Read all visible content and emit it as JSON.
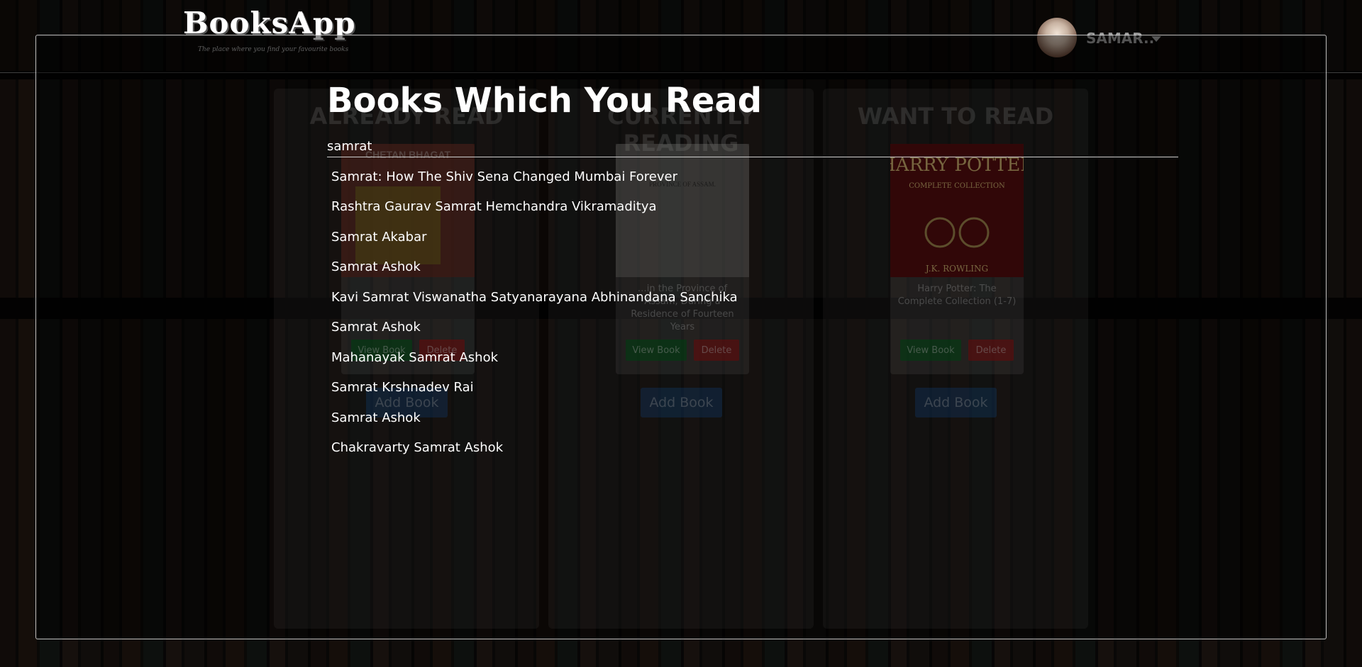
{
  "header": {
    "logo": "BooksApp",
    "tagline": "The place where you find your favourite books",
    "username": "SAMAR.."
  },
  "columns": [
    {
      "title": "ALREADY READ",
      "book": {
        "title": "",
        "cover_text": "CHETAN BHAGAT",
        "view_label": "View Book",
        "delete_label": "Delete"
      },
      "add_label": "Add Book"
    },
    {
      "title": "CURRENTLY READING",
      "book": {
        "title": "…in the Province of Assam, During a Residence of Fourteen Years",
        "cover_text": "PROVINCE OF ASSAM.",
        "view_label": "View Book",
        "delete_label": "Delete"
      },
      "add_label": "Add Book"
    },
    {
      "title": "WANT TO READ",
      "book": {
        "title": "Harry Potter: The Complete Collection (1-7)",
        "cover_text": "HARRY POTTER",
        "cover_sub": "COMPLETE COLLECTION",
        "cover_author": "J.K. ROWLING",
        "view_label": "View Book",
        "delete_label": "Delete"
      },
      "add_label": "Add Book"
    }
  ],
  "modal": {
    "title": "Books Which You Read",
    "search_value": "samrat",
    "suggestions": [
      "Samrat: How The Shiv Sena Changed Mumbai Forever",
      "Rashtra Gaurav Samrat Hemchandra Vikramaditya",
      "Samrat Akabar",
      "Samrat Ashok",
      "Kavi Samrat Viswanatha Satyanarayana Abhinandana Sanchika",
      "Samrat Ashok",
      "Mahanayak Samrat Ashok",
      "Samrat Krshnadev Rai",
      "Samrat Ashok",
      "Chakravarty Samrat Ashok"
    ]
  },
  "colors": {
    "view_button": "#0a6e1e",
    "delete_button": "#b41414",
    "add_button": "#1e6ec8"
  }
}
